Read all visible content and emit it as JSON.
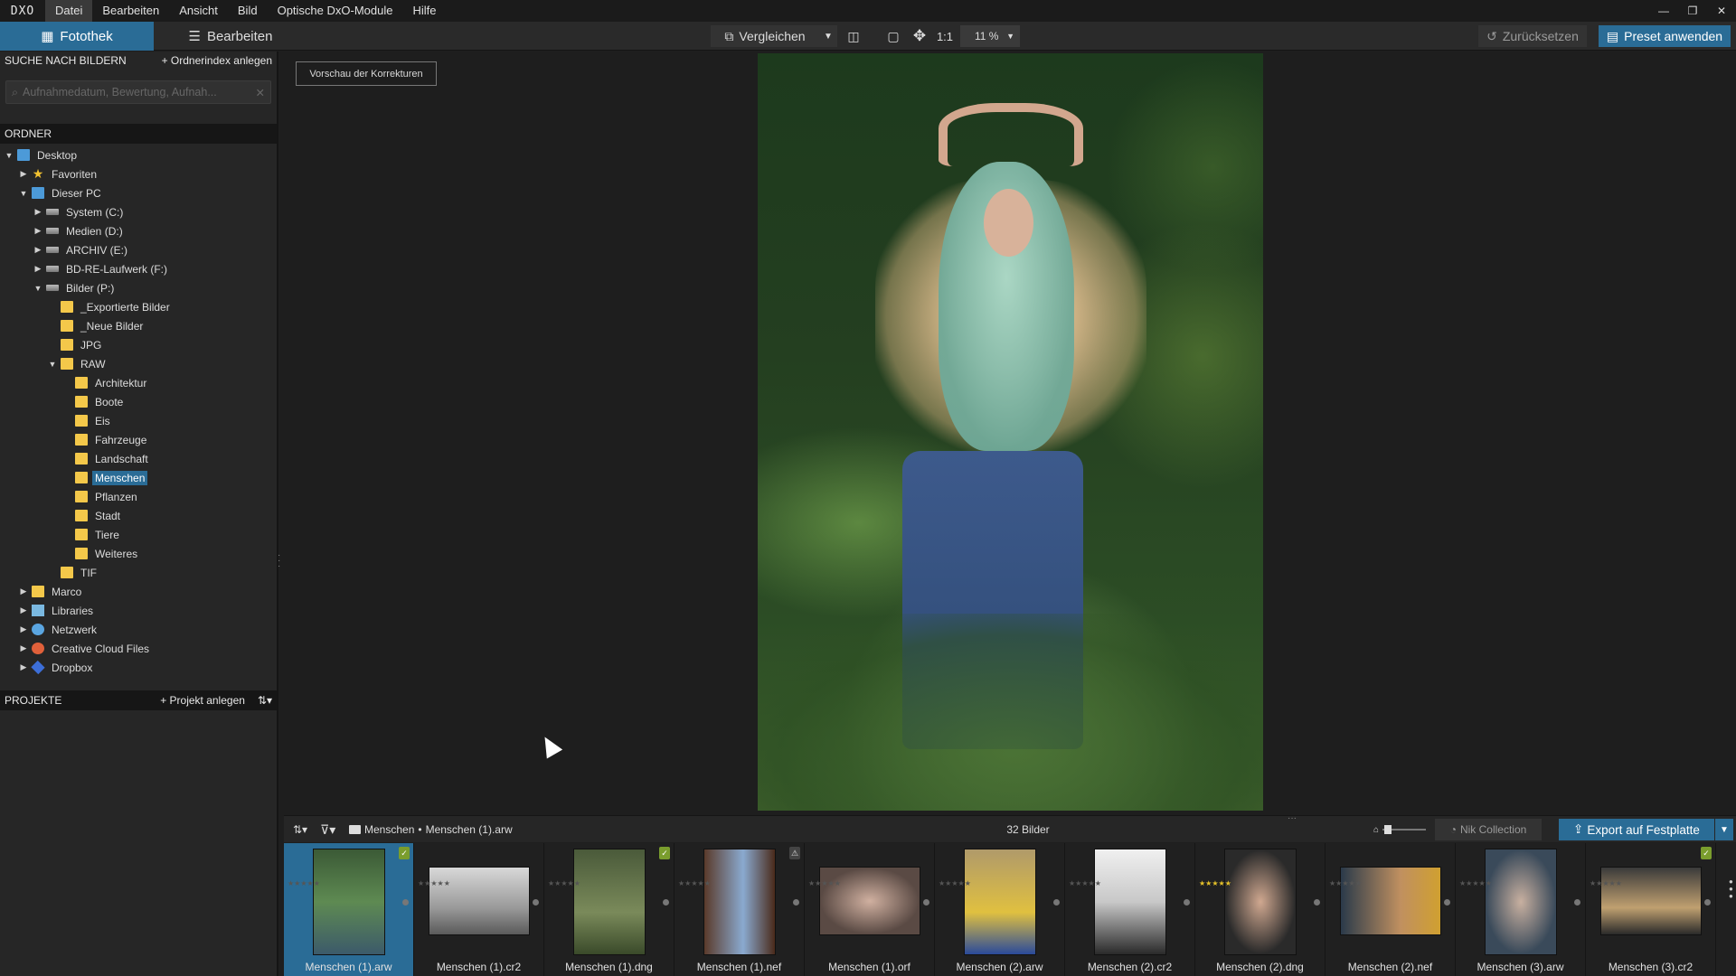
{
  "app": {
    "logo": "DXO"
  },
  "menu": [
    "Datei",
    "Bearbeiten",
    "Ansicht",
    "Bild",
    "Optische DxO-Module",
    "Hilfe"
  ],
  "window": {
    "minimize": "—",
    "restore": "❐",
    "close": "✕"
  },
  "tabs": {
    "photolibrary": "Fotothek",
    "edit": "Bearbeiten"
  },
  "toolbar": {
    "compare": "Vergleichen",
    "one_to_one": "1:1",
    "zoom": "11 %",
    "reset": "Zurücksetzen",
    "apply_preset": "Preset anwenden"
  },
  "search": {
    "title": "SUCHE NACH BILDERN",
    "create_index": "+ Ordnerindex anlegen",
    "placeholder": "Aufnahmedatum, Bewertung, Aufnah..."
  },
  "folders": {
    "title": "ORDNER",
    "tree": [
      {
        "label": "Desktop",
        "depth": 0,
        "arrow": "▼",
        "icon": "desktop-icon"
      },
      {
        "label": "Favoriten",
        "depth": 1,
        "arrow": "▶",
        "icon": "star-icon"
      },
      {
        "label": "Dieser PC",
        "depth": 1,
        "arrow": "▼",
        "icon": "computer-icon"
      },
      {
        "label": "System (C:)",
        "depth": 2,
        "arrow": "▶",
        "icon": "system-drive-icon"
      },
      {
        "label": "Medien (D:)",
        "depth": 2,
        "arrow": "▶",
        "icon": "drive-icon"
      },
      {
        "label": "ARCHIV (E:)",
        "depth": 2,
        "arrow": "▶",
        "icon": "drive-icon"
      },
      {
        "label": "BD-RE-Laufwerk (F:)",
        "depth": 2,
        "arrow": "▶",
        "icon": "network-drive-icon"
      },
      {
        "label": "Bilder (P:)",
        "depth": 2,
        "arrow": "▼",
        "icon": "drive-icon"
      },
      {
        "label": "_Exportierte Bilder",
        "depth": 3,
        "arrow": "",
        "icon": "folder-icon"
      },
      {
        "label": "_Neue Bilder",
        "depth": 3,
        "arrow": "",
        "icon": "folder-icon"
      },
      {
        "label": "JPG",
        "depth": 3,
        "arrow": "",
        "icon": "folder-icon"
      },
      {
        "label": "RAW",
        "depth": 3,
        "arrow": "▼",
        "icon": "folder-icon"
      },
      {
        "label": "Architektur",
        "depth": 4,
        "arrow": "",
        "icon": "folder-icon"
      },
      {
        "label": "Boote",
        "depth": 4,
        "arrow": "",
        "icon": "folder-icon"
      },
      {
        "label": "Eis",
        "depth": 4,
        "arrow": "",
        "icon": "folder-icon"
      },
      {
        "label": "Fahrzeuge",
        "depth": 4,
        "arrow": "",
        "icon": "folder-icon"
      },
      {
        "label": "Landschaft",
        "depth": 4,
        "arrow": "",
        "icon": "folder-icon"
      },
      {
        "label": "Menschen",
        "depth": 4,
        "arrow": "",
        "icon": "folder-icon",
        "selected": true
      },
      {
        "label": "Pflanzen",
        "depth": 4,
        "arrow": "",
        "icon": "folder-icon"
      },
      {
        "label": "Stadt",
        "depth": 4,
        "arrow": "",
        "icon": "folder-icon"
      },
      {
        "label": "Tiere",
        "depth": 4,
        "arrow": "",
        "icon": "folder-icon"
      },
      {
        "label": "Weiteres",
        "depth": 4,
        "arrow": "",
        "icon": "folder-icon"
      },
      {
        "label": "TIF",
        "depth": 3,
        "arrow": "",
        "icon": "folder-icon"
      },
      {
        "label": "Marco",
        "depth": 1,
        "arrow": "▶",
        "icon": "folder-icon"
      },
      {
        "label": "Libraries",
        "depth": 1,
        "arrow": "▶",
        "icon": "libraries-icon"
      },
      {
        "label": "Netzwerk",
        "depth": 1,
        "arrow": "▶",
        "icon": "network-icon"
      },
      {
        "label": "Creative Cloud Files",
        "depth": 1,
        "arrow": "▶",
        "icon": "creative-cloud-icon"
      },
      {
        "label": "Dropbox",
        "depth": 1,
        "arrow": "▶",
        "icon": "dropbox-icon"
      }
    ]
  },
  "projects": {
    "title": "PROJEKTE",
    "create": "+ Projekt anlegen"
  },
  "viewer": {
    "preview_corrections": "Vorschau der Korrekturen"
  },
  "filmstrip": {
    "breadcrumb_folder": "Menschen",
    "breadcrumb_separator": "•",
    "breadcrumb_file": "Menschen (1).arw",
    "count": "32 Bilder",
    "nik": "Nik Collection",
    "export": "Export auf Festplatte",
    "items": [
      {
        "name": "Menschen (1).arw",
        "selected": true,
        "orient": "portrait",
        "bg": "linear-gradient(#3b5a36,#5e8a52 50%,#3c5a6a)",
        "badge": "green",
        "rating": 0
      },
      {
        "name": "Menschen (1).cr2",
        "orient": "land",
        "bg": "linear-gradient(#d8d8d8,#9a9a9a 60%,#5a5a5a)",
        "rating": 0
      },
      {
        "name": "Menschen (1).dng",
        "orient": "portrait",
        "bg": "linear-gradient(#4a5a3a,#7a8a5a 60%,#3a4a2a)",
        "badge": "green",
        "rating": 0
      },
      {
        "name": "Menschen (1).nef",
        "orient": "portrait",
        "bg": "linear-gradient(90deg,#5a3a2a,#8aaad0 55%,#4a2a1a)",
        "badge": "warn",
        "rating": 0
      },
      {
        "name": "Menschen (1).orf",
        "orient": "land",
        "bg": "radial-gradient(#d0b0a0,#5a4a44 70%)",
        "rating": 0
      },
      {
        "name": "Menschen (2).arw",
        "orient": "portrait",
        "bg": "linear-gradient(#b09a6a,#e0c040 60%,#2a4a9a)",
        "rating": 0
      },
      {
        "name": "Menschen (2).cr2",
        "orient": "portrait",
        "bg": "linear-gradient(#f0f0f0,#c8c8c8 50%,#2a2a2a)",
        "rating": 0
      },
      {
        "name": "Menschen (2).dng",
        "orient": "portrait",
        "bg": "radial-gradient(#d0a890,#2a2a2a 70%)",
        "rating": 3
      },
      {
        "name": "Menschen (2).nef",
        "orient": "land",
        "bg": "linear-gradient(90deg,#2a3a4a,#c09060 60%,#d0a030)",
        "rating": 0
      },
      {
        "name": "Menschen (3).arw",
        "orient": "portrait",
        "bg": "radial-gradient(#c8b0a0,#3a4a5a 70%)",
        "rating": 0
      },
      {
        "name": "Menschen (3).cr2",
        "orient": "land",
        "bg": "linear-gradient(#3a3a3a,#c0a070 60%,#2a2a2a)",
        "badge": "green",
        "rating": 0
      }
    ]
  }
}
